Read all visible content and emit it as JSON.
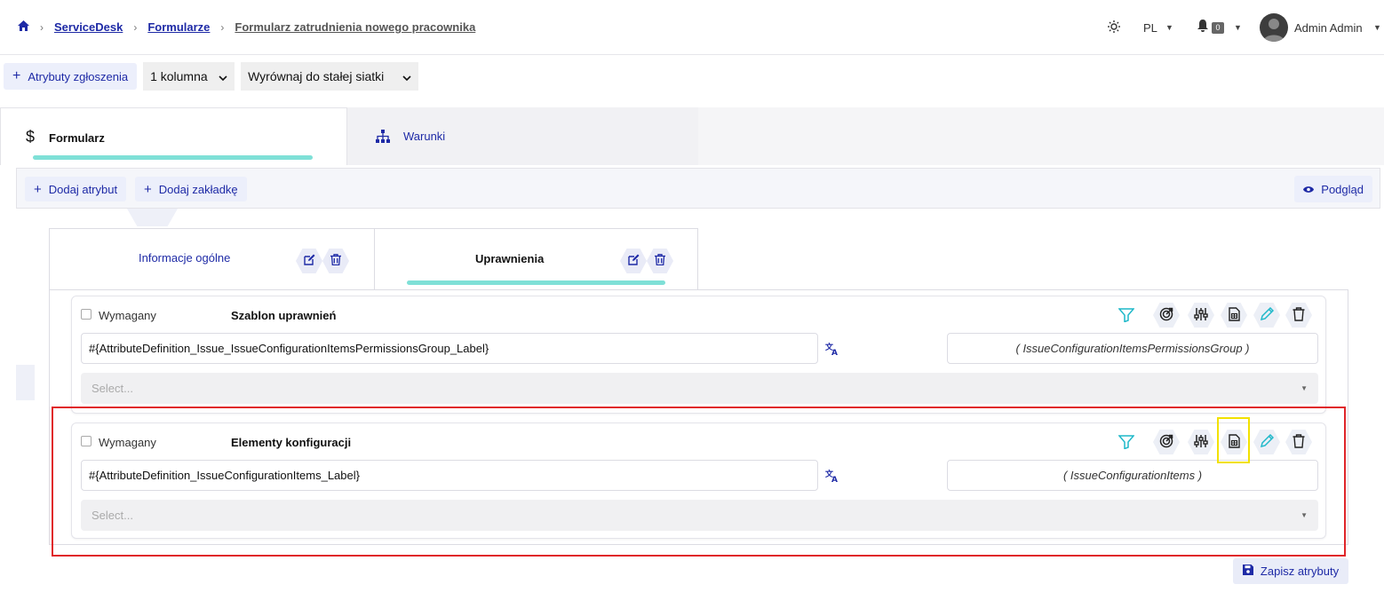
{
  "breadcrumb": {
    "items": [
      "ServiceDesk",
      "Formularze"
    ],
    "current": "Formularz zatrudnienia nowego pracownika"
  },
  "topbar": {
    "language": "PL",
    "notifications_count": "0",
    "user_name": "Admin Admin"
  },
  "toolbar": {
    "add_attributes_label": "Atrybuty zgłoszenia",
    "columns_value": "1 kolumna",
    "align_value": "Wyrównaj do stałej siatki"
  },
  "main_tabs": [
    {
      "label": "Formularz",
      "icon": "dollar-icon",
      "active": true
    },
    {
      "label": "Warunki",
      "icon": "sitemap-icon",
      "active": false
    }
  ],
  "panel": {
    "add_attribute_label": "Dodaj atrybut",
    "add_tab_label": "Dodaj zakładkę",
    "preview_label": "Podgląd"
  },
  "form_tabs": [
    {
      "label": "Informacje ogólne",
      "active": false
    },
    {
      "label": "Uprawnienia",
      "active": true
    }
  ],
  "attributes": [
    {
      "required_label": "Wymagany",
      "name": "Szablon uprawnień",
      "label_value": "#{AttributeDefinition_Issue_IssueConfigurationItemsPermissionsGroup_Label}",
      "code": "( IssueConfigurationItemsPermissionsGroup )",
      "select_placeholder": "Select..."
    },
    {
      "required_label": "Wymagany",
      "name": "Elementy konfiguracji",
      "label_value": "#{AttributeDefinition_IssueConfigurationItems_Label}",
      "code": "( IssueConfigurationItems )",
      "select_placeholder": "Select..."
    }
  ],
  "footer": {
    "save_label": "Zapisz atrybuty"
  },
  "colors": {
    "accent": "#1e2aa6",
    "tab_underline": "#7fe0d7",
    "highlight_red": "#e0262a",
    "highlight_yellow": "#f2e100",
    "filter_icon": "#1fb8c9"
  }
}
